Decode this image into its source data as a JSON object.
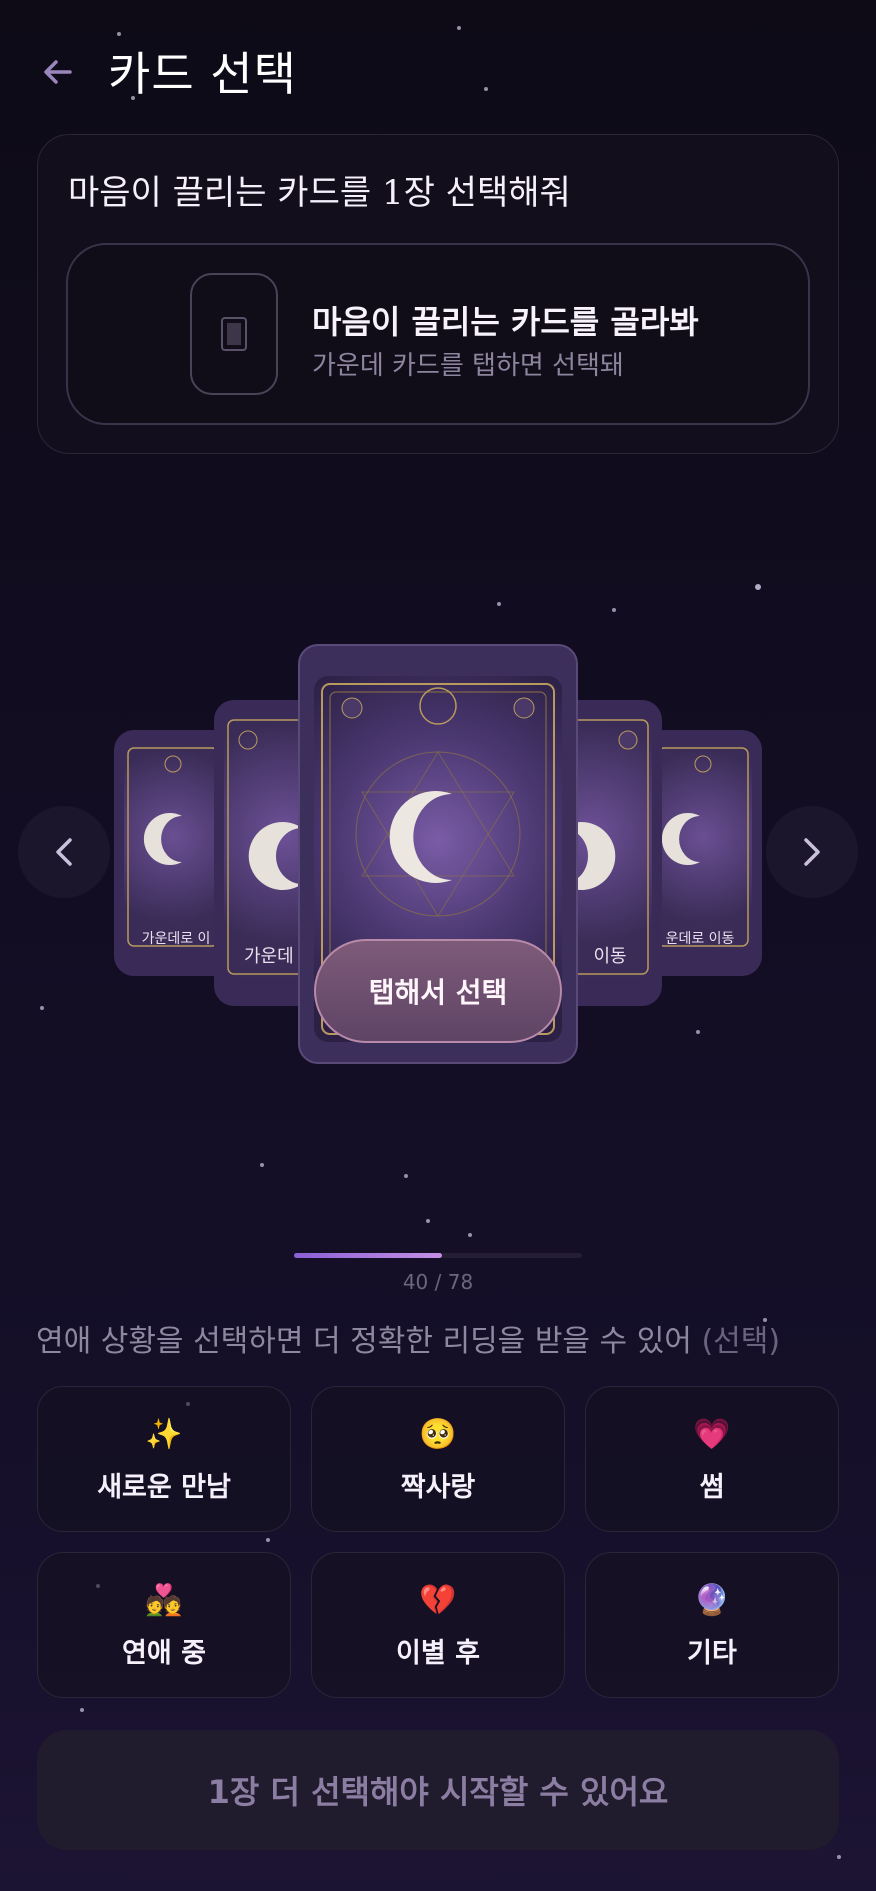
{
  "header": {
    "title": "카드 선택",
    "back_icon": "arrow-left-icon"
  },
  "panel": {
    "title": "마음이 끌리는 카드를 1장 선택해줘",
    "hint_title": "마음이 끌리는 카드를 골라봐",
    "hint_subtitle": "가운데 카드를 탭하면 선택돼"
  },
  "carousel": {
    "side_label": "가운데로 이동",
    "far_left_label": "가운데로 이",
    "left_label": "가운데",
    "right_label": "이동",
    "far_right_label": "운데로 이동",
    "tap_label": "탭해서 선택",
    "accent": "#3a2a57"
  },
  "progress": {
    "current": 40,
    "total": 78,
    "text": "40 / 78"
  },
  "situation": {
    "prompt": "연애 상황을 선택하면 더 정확한 리딩을 받을 수 있어",
    "optional": "(선택)"
  },
  "chips": [
    {
      "emoji": "✨",
      "label": "새로운 만남"
    },
    {
      "emoji": "🥺",
      "label": "짝사랑"
    },
    {
      "emoji": "💗",
      "label": "썸"
    },
    {
      "emoji": "💑",
      "label": "연애 중"
    },
    {
      "emoji": "💔",
      "label": "이별 후"
    },
    {
      "emoji": "🔮",
      "label": "기타"
    }
  ],
  "start_button": "1장 더 선택해야 시작할 수 있어요",
  "colors": {
    "background": "#120d22",
    "card": "#3a2a57",
    "accent": "#b88aa9"
  }
}
